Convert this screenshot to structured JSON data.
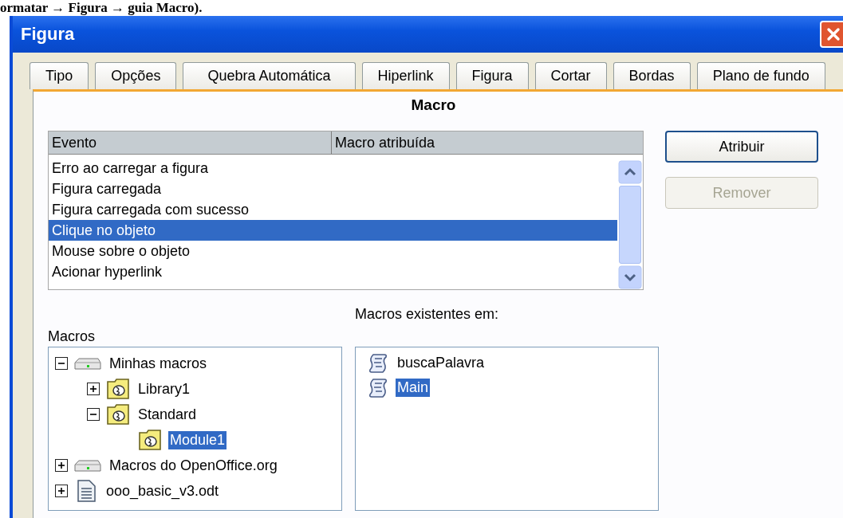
{
  "caption": "ormatar → Figura → guia Macro).",
  "window": {
    "title": "Figura"
  },
  "tabs": [
    {
      "label": "Tipo",
      "selected": false
    },
    {
      "label": "Opções",
      "selected": false
    },
    {
      "label": "Quebra Automática",
      "selected": false
    },
    {
      "label": "Hiperlink",
      "selected": false
    },
    {
      "label": "Figura",
      "selected": false
    },
    {
      "label": "Cortar",
      "selected": false
    },
    {
      "label": "Bordas",
      "selected": false
    },
    {
      "label": "Plano de fundo",
      "selected": false
    }
  ],
  "page_title": "Macro",
  "events": {
    "columns": [
      "Evento",
      "Macro atribuída"
    ],
    "rows": [
      {
        "event": "Erro ao carregar a figura",
        "selected": false
      },
      {
        "event": "Figura carregada",
        "selected": false
      },
      {
        "event": "Figura carregada com sucesso",
        "selected": false
      },
      {
        "event": "Clique no objeto",
        "selected": true
      },
      {
        "event": "Mouse sobre o objeto",
        "selected": false
      },
      {
        "event": "Acionar hyperlink",
        "selected": false
      }
    ]
  },
  "buttons": [
    {
      "label": "Atribuir",
      "disabled": false
    },
    {
      "label": "Remover",
      "disabled": true
    }
  ],
  "macros_label": "Macros",
  "tree": [
    {
      "label": "Minhas macros",
      "kind": "drive",
      "expanded": true,
      "selected": false,
      "children": [
        {
          "label": "Library1",
          "kind": "library",
          "expanded": false,
          "selected": false
        },
        {
          "label": "Standard",
          "kind": "library",
          "expanded": true,
          "selected": false,
          "children": [
            {
              "label": "Module1",
              "kind": "library",
              "selected": true
            }
          ]
        }
      ]
    },
    {
      "label": "Macros do OpenOffice.org",
      "kind": "drive",
      "expanded": false,
      "selected": false
    },
    {
      "label": "ooo_basic_v3.odt",
      "kind": "document",
      "expanded": false,
      "selected": false
    }
  ],
  "existing_label": "Macros existentes em:",
  "macros": [
    {
      "name": "buscaPalavra",
      "selected": false
    },
    {
      "name": "Main",
      "selected": true
    }
  ]
}
